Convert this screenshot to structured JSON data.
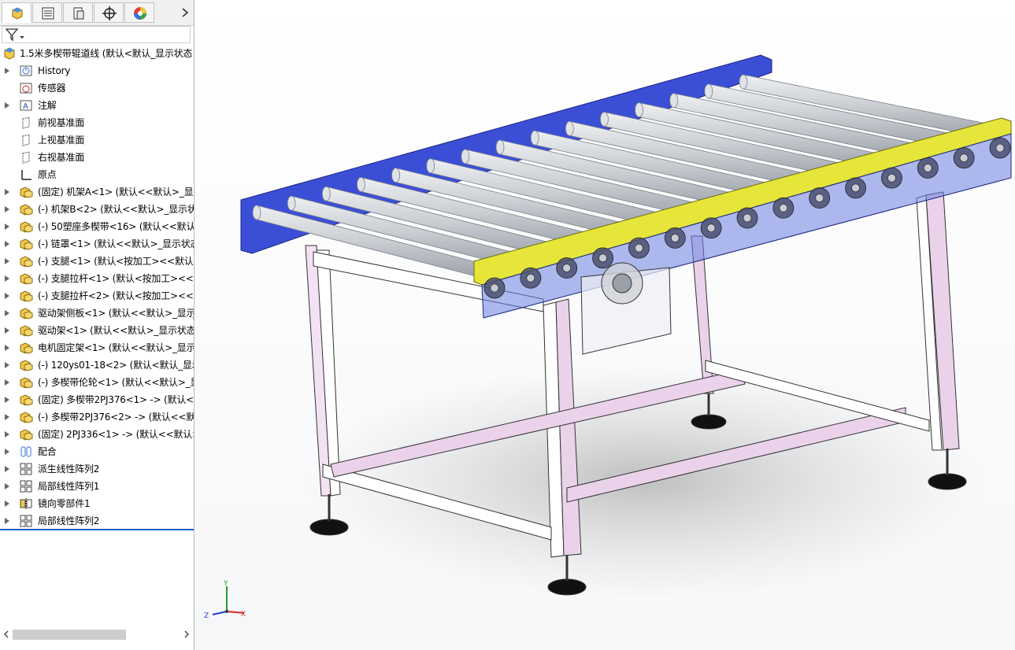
{
  "window": {
    "title": "1.5米多楔带辊道线"
  },
  "manager_tabs": [
    {
      "name": "feature-manager",
      "icon": "featuremanager-icon",
      "active": true
    },
    {
      "name": "property-manager",
      "icon": "propertymanager-icon",
      "active": false
    },
    {
      "name": "configuration-manager",
      "icon": "configurationmanager-icon",
      "active": false
    },
    {
      "name": "dimxpert-manager",
      "icon": "crosshair-icon",
      "active": false
    },
    {
      "name": "display-manager",
      "icon": "color-wheel-icon",
      "active": false
    }
  ],
  "filter": {
    "icon": "filter-icon"
  },
  "tree": {
    "root": {
      "label": "1.5米多楔带辊道线  (默认<默认_显示状态",
      "icon": "assembly-icon"
    },
    "items": [
      {
        "label": "History",
        "icon": "history-icon",
        "expand": true
      },
      {
        "label": "传感器",
        "icon": "sensor-icon",
        "expand": false
      },
      {
        "label": "注解",
        "icon": "annotation-icon",
        "expand": true
      },
      {
        "label": "前视基准面",
        "icon": "plane-icon",
        "expand": false
      },
      {
        "label": "上视基准面",
        "icon": "plane-icon",
        "expand": false
      },
      {
        "label": "右视基准面",
        "icon": "plane-icon",
        "expand": false
      },
      {
        "label": "原点",
        "icon": "origin-icon",
        "expand": false
      },
      {
        "label": "(固定) 机架A<1> (默认<<默认>_显示",
        "icon": "subassembly-icon",
        "expand": true
      },
      {
        "label": "(-) 机架B<2> (默认<<默认>_显示状态",
        "icon": "subassembly-icon",
        "expand": true
      },
      {
        "label": "(-) 50塑座多楔带<16> (默认<<默认>",
        "icon": "subassembly-icon",
        "expand": true
      },
      {
        "label": "(-) 链罩<1> (默认<<默认>_显示状态",
        "icon": "subassembly-icon",
        "expand": true
      },
      {
        "label": "(-) 支腿<1> (默认<按加工><<默认",
        "icon": "subassembly-icon",
        "expand": true
      },
      {
        "label": "(-) 支腿拉杆<1> (默认<按加工><<默",
        "icon": "subassembly-icon",
        "expand": true
      },
      {
        "label": "(-) 支腿拉杆<2> (默认<按加工><<默",
        "icon": "subassembly-icon",
        "expand": true
      },
      {
        "label": "驱动架侧板<1> (默认<<默认>_显示",
        "icon": "subassembly-icon",
        "expand": true
      },
      {
        "label": "驱动架<1> (默认<<默认>_显示状态",
        "icon": "subassembly-icon",
        "expand": true
      },
      {
        "label": "电机固定架<1> (默认<<默认>_显示",
        "icon": "subassembly-icon",
        "expand": true
      },
      {
        "label": "(-) 120ys01-18<2> (默认<默认_显示",
        "icon": "subassembly-icon",
        "expand": true
      },
      {
        "label": "(-) 多楔带伦轮<1> (默认<<默认>_显",
        "icon": "subassembly-icon",
        "expand": true
      },
      {
        "label": "(固定) 多楔带2PJ376<1> -> (默认<",
        "icon": "subassembly-icon",
        "expand": true
      },
      {
        "label": "(-) 多楔带2PJ376<2> -> (默认<<默",
        "icon": "subassembly-icon",
        "expand": true
      },
      {
        "label": "(固定) 2PJ336<1> -> (默认<<默认>",
        "icon": "subassembly-icon",
        "expand": true
      },
      {
        "label": "配合",
        "icon": "mates-icon",
        "expand": true
      },
      {
        "label": "派生线性阵列2",
        "icon": "pattern-icon",
        "expand": true
      },
      {
        "label": "局部线性阵列1",
        "icon": "pattern-icon",
        "expand": true
      },
      {
        "label": "镜向零部件1",
        "icon": "mirror-icon",
        "expand": true
      },
      {
        "label": "局部线性阵列2",
        "icon": "pattern-icon",
        "expand": true
      }
    ]
  },
  "viewport": {
    "content": "roller-conveyor-assembly",
    "triad": {
      "x": "X",
      "y": "Y",
      "z": "Z"
    }
  },
  "colors": {
    "frame_blue": "#3b4fd6",
    "guard_yellow": "#e6e63a",
    "leg_pink": "#ead2ea",
    "roller_gray": "#cfd2d6",
    "tree_end_line": "#1f5fbf"
  }
}
